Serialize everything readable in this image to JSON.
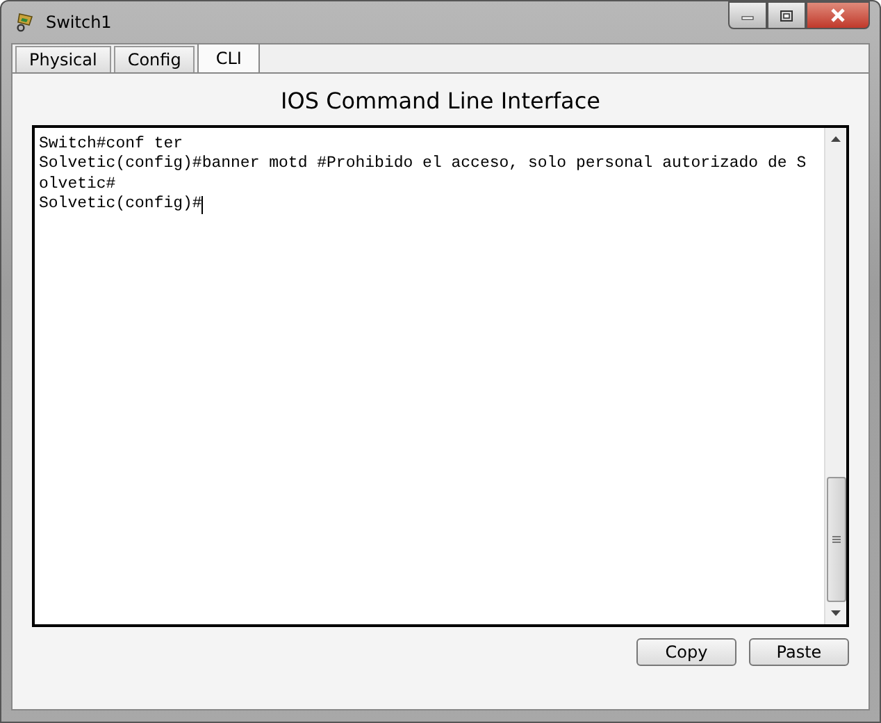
{
  "window": {
    "title": "Switch1"
  },
  "tabs": [
    {
      "label": "Physical",
      "selected": false
    },
    {
      "label": "Config",
      "selected": false
    },
    {
      "label": "CLI",
      "selected": true
    }
  ],
  "heading": "IOS Command Line Interface",
  "terminal": {
    "lines": [
      "Switch#conf ter",
      "Solvetic(config)#banner motd #Prohibido el acceso, solo personal autorizado de S",
      "olvetic#",
      "Solvetic(config)#"
    ],
    "cursor": true
  },
  "buttons": [
    "Copy",
    "Paste"
  ]
}
